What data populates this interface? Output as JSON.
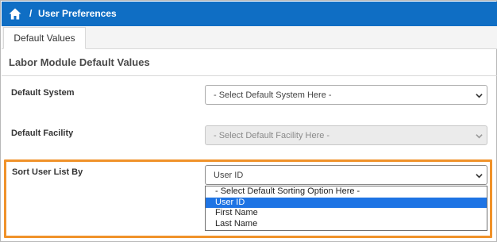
{
  "header": {
    "breadcrumb_separator": "/",
    "page_title": "User Preferences",
    "icon": "home-icon",
    "bar_color": "#0f6ec4"
  },
  "tabs": [
    {
      "label": "Default Values",
      "active": true
    }
  ],
  "section": {
    "title": "Labor Module Default Values"
  },
  "fields": {
    "default_system": {
      "label": "Default System",
      "value": "- Select Default System Here -",
      "disabled": false
    },
    "default_facility": {
      "label": "Default Facility",
      "value": "- Select Default Facility Here -",
      "disabled": true
    },
    "sort_user_list": {
      "label": "Sort User List By",
      "value": "User ID",
      "options": [
        "- Select Default Sorting Option Here -",
        "User ID",
        "First Name",
        "Last Name"
      ],
      "selected_option": "User ID",
      "dropdown_open": true
    }
  },
  "colors": {
    "highlight_border": "#f0922a",
    "selected_option_bg": "#1e74e4"
  }
}
